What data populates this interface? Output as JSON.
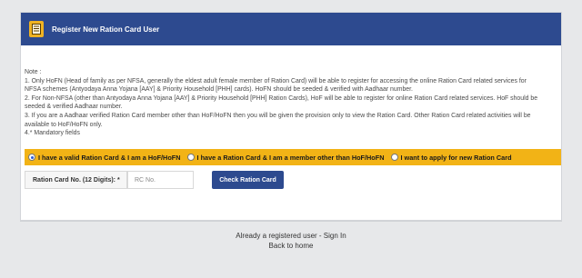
{
  "header": {
    "title": "Register New Ration Card User",
    "icon": "document-icon"
  },
  "notes": {
    "heading": "Note :",
    "lines": [
      "1. Only HoFN (Head of family as per NFSA, generally the eldest adult female member of Ration Card) will be able to register for accessing the online Ration Card related services for",
      "NFSA schemes (Antyodaya Anna Yojana [AAY] & Priority Household [PHH] cards). HoFN should be seeded & verified with Aadhaar number.",
      "2. For Non-NFSA (other than Antyodaya Anna Yojana [AAY] & Priority Household [PHH] Ration Cards), HoF will be able to register for online Ration Card related services. HoF should be",
      "seeded & verified Aadhaar number.",
      "3. If you are a Aadhaar verified Ration Card member other than HoF/HoFN then you will be given the provision only to view the Ration Card. Other Ration Card related activities will be",
      "available to HoF/HoFN only.",
      "4.* Mandatory fields"
    ]
  },
  "options": {
    "opt1": "I have a valid Ration Card & I am a HoF/HoFN",
    "opt2": "I have a Ration Card & I am a member other than HoF/HoFN",
    "opt3": "I want to apply for new Ration Card",
    "selected": "opt1"
  },
  "form": {
    "label": "Ration Card No. (12 Digits): *",
    "placeholder": "RC No.",
    "value": "",
    "button": "Check Ration Card"
  },
  "links": {
    "sign_in": "Already a registered user - Sign In",
    "back": "Back to home"
  },
  "colors": {
    "header_bg": "#2d4a8f",
    "accent": "#f2b316",
    "page_bg": "#e7e8ea"
  }
}
